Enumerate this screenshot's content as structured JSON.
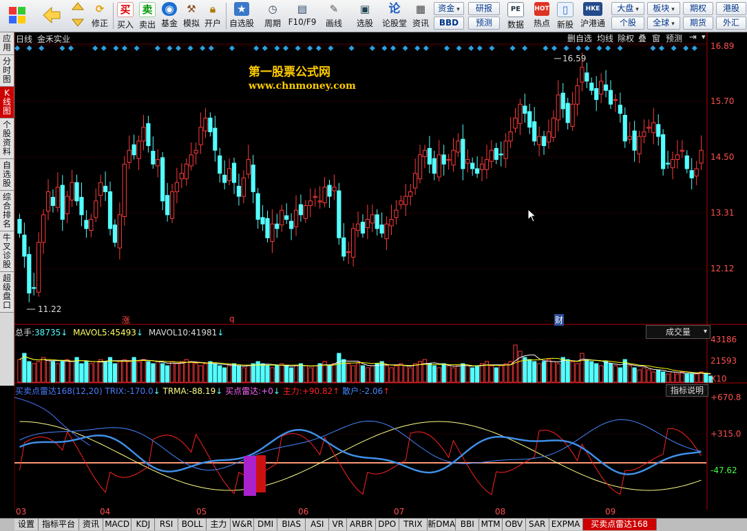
{
  "toolbar": {
    "buy": "买入",
    "sell": "卖出",
    "fund": "基金",
    "simulate": "模拟",
    "open_account": "开户",
    "modify": "修正",
    "watchlist": "自选股",
    "period": "周期",
    "f10": "F10/F9",
    "draw": "画线",
    "stock_pick": "选股",
    "forum": "论股堂",
    "news": "资讯",
    "capital": "资金",
    "bbd": "BBD",
    "research": "研报",
    "forecast": "预测",
    "data": "数据",
    "hot": "热点",
    "new_stock": "新股",
    "hk_connect": "沪港通",
    "market": "大盘",
    "sector": "板块",
    "futures": "期权",
    "hk_stock": "港股",
    "single_stock": "个股",
    "global": "全球",
    "futures2": "期货",
    "forex": "外汇",
    "pe_icon_text": "PE",
    "hot_icon_text": "HOT",
    "hk_icon_text": "HKE"
  },
  "left_tabs": [
    "应用",
    "分时图",
    "K线图",
    "个股资料",
    "自选股",
    "综合排名",
    "牛叉诊股",
    "超级盘口"
  ],
  "chart_header": {
    "period": "日线",
    "stock_name": "金禾实业",
    "buttons": [
      "删自选",
      "均线",
      "除权",
      "叠",
      "窗",
      "预测"
    ]
  },
  "watermark": {
    "title": "第一股票公式网",
    "url": "www.chnmoney.com"
  },
  "colors": {
    "up": "#ff3b3b",
    "down": "#54ffff",
    "axis": "#b40000",
    "price_label": "#ff5050",
    "ma5": "#ffffff",
    "ma10": "#ffff00",
    "trix": "#4477ff",
    "trma": "#ffff88",
    "main_force": "#ff2222",
    "retail": "#4488ff"
  },
  "price_axis": {
    "labels": [
      "16.89",
      "15.70",
      "14.50",
      "13.31",
      "12.12"
    ],
    "max": 16.89,
    "min": 11.0
  },
  "extremes": {
    "high": "16.59",
    "low": "11.22"
  },
  "event_markers": [
    {
      "text": "涨",
      "pos": 0.155
    },
    {
      "text": "q",
      "pos": 0.31
    },
    {
      "text": "财",
      "pos": 0.78
    }
  ],
  "volume_panel": {
    "total_label": "总手:",
    "total": "38735",
    "ma5_label": "MAVOL5:",
    "ma5": "45493",
    "ma10_label": "MAVOL10:",
    "ma10": "41981",
    "dropdown": "成交量",
    "axis": [
      "43186",
      "21593"
    ],
    "unit": "X10"
  },
  "indicator_panel": {
    "name": "买卖点雷达168(12,20)",
    "trix_label": "TRIX:",
    "trix": "-170.0",
    "trma_label": "TRMA:",
    "trma": "-88.19",
    "radar_label": "买点雷达:",
    "radar": "+0",
    "main_label": "主力:",
    "main": "+90.82",
    "retail_label": "散户:",
    "retail": "-2.06",
    "help_button": "指标说明",
    "axis": [
      "+670.8",
      "+315.0",
      "-47.62"
    ]
  },
  "months": [
    "03",
    "04",
    "05",
    "06",
    "07",
    "08",
    "09"
  ],
  "bottom_tabs": [
    "设置",
    "指标平台",
    "资讯",
    "MACD",
    "KDJ",
    "RSI",
    "BOLL",
    "主力",
    "W&R",
    "DMI",
    "BIAS",
    "ASI",
    "VR",
    "ARBR",
    "DPO",
    "TRIX",
    "新DMA",
    "BBI",
    "MTM",
    "OBV",
    "SAR",
    "EXPMA",
    "买卖点雷达168"
  ],
  "active_bottom_tab": "买卖点雷达168",
  "chart_data": {
    "type": "candlestick",
    "title": "",
    "xlabel": "",
    "ylabel": "",
    "ylim": [
      11.0,
      16.89
    ],
    "close": [
      12.8,
      12.3,
      11.5,
      11.6,
      12.6,
      13.2,
      13.7,
      13.4,
      13.8,
      13.1,
      13.6,
      13.9,
      13.5,
      13.2,
      12.9,
      13.1,
      13.5,
      13.9,
      13.7,
      12.9,
      12.6,
      13.2,
      14.3,
      14.6,
      14.5,
      14.8,
      15.1,
      14.7,
      14.3,
      14.4,
      13.5,
      13.2,
      13.7,
      13.9,
      14.1,
      14.3,
      14.5,
      14.6,
      15.1,
      15.3,
      15.0,
      14.6,
      14.1,
      13.9,
      14.2,
      13.9,
      13.6,
      14.0,
      14.4,
      13.7,
      13.1,
      13.0,
      12.7,
      13.0,
      12.9,
      13.3,
      13.1,
      12.9,
      13.3,
      13.2,
      13.4,
      13.5,
      13.6,
      13.5,
      13.8,
      13.6,
      13.8,
      12.7,
      12.3,
      12.4,
      12.9,
      13.0,
      12.8,
      13.1,
      13.2,
      12.9,
      12.8,
      13.0,
      13.1,
      13.3,
      13.5,
      13.6,
      13.7,
      14.1,
      14.5,
      14.6,
      14.3,
      14.1,
      14.5,
      14.3,
      14.4,
      14.6,
      14.8,
      14.2,
      14.4,
      14.2,
      14.1,
      14.3,
      14.4,
      14.6,
      14.4,
      14.5,
      14.8,
      15.0,
      15.3,
      15.6,
      15.4,
      15.1,
      14.8,
      14.9,
      14.7,
      15.0,
      15.3,
      15.8,
      15.5,
      15.2,
      15.6,
      16.0,
      16.4,
      16.1,
      15.9,
      15.7,
      16.1,
      15.9,
      15.6,
      15.7,
      15.4,
      14.8,
      14.9,
      14.6,
      14.9,
      15.0,
      15.1,
      15.2,
      14.9,
      14.2,
      14.3,
      14.4,
      14.5,
      14.6,
      14.2,
      14.0,
      14.2,
      14.6
    ],
    "volume": [
      0.55,
      0.7,
      0.5,
      0.45,
      0.5,
      0.6,
      0.55,
      0.5,
      0.45,
      0.5,
      0.55,
      0.5,
      0.6,
      0.45,
      0.5,
      0.45,
      0.5,
      0.55,
      0.5,
      0.6,
      0.45,
      0.5,
      0.55,
      0.5,
      0.6,
      0.5,
      0.55,
      0.5,
      0.45,
      0.5,
      0.45,
      0.4,
      0.5,
      0.45,
      0.5,
      0.55,
      0.5,
      0.45,
      0.4,
      0.45,
      0.5,
      0.45,
      0.4,
      0.35,
      0.4,
      0.45,
      0.4,
      0.35,
      0.4,
      0.45,
      0.5,
      0.45,
      0.4,
      0.35,
      0.4,
      0.45,
      0.4,
      0.35,
      0.4,
      0.45,
      0.4,
      0.35,
      0.4,
      0.45,
      0.5,
      0.4,
      0.45,
      0.7,
      0.55,
      0.45,
      0.4,
      0.45,
      0.4,
      0.35,
      0.4,
      0.45,
      0.5,
      0.4,
      0.35,
      0.4,
      0.45,
      0.4,
      0.35,
      0.45,
      0.5,
      0.55,
      0.45,
      0.4,
      0.35,
      0.45,
      0.4,
      0.35,
      0.4,
      0.45,
      0.4,
      0.35,
      0.4,
      0.45,
      0.5,
      0.4,
      0.35,
      0.4,
      0.45,
      0.5,
      0.9,
      0.75,
      0.6,
      0.55,
      0.5,
      0.45,
      0.5,
      0.55,
      0.5,
      0.45,
      0.6,
      0.55,
      0.5,
      0.45,
      0.7,
      0.55,
      0.5,
      0.45,
      0.4,
      0.5,
      0.45,
      0.4,
      0.35,
      0.55,
      0.4,
      0.35,
      0.3,
      0.35,
      0.3,
      0.25,
      0.3,
      0.25,
      0.2,
      0.25,
      0.2,
      0.25,
      0.2,
      0.2,
      0.2,
      0.25,
      0.2,
      0.15
    ]
  }
}
